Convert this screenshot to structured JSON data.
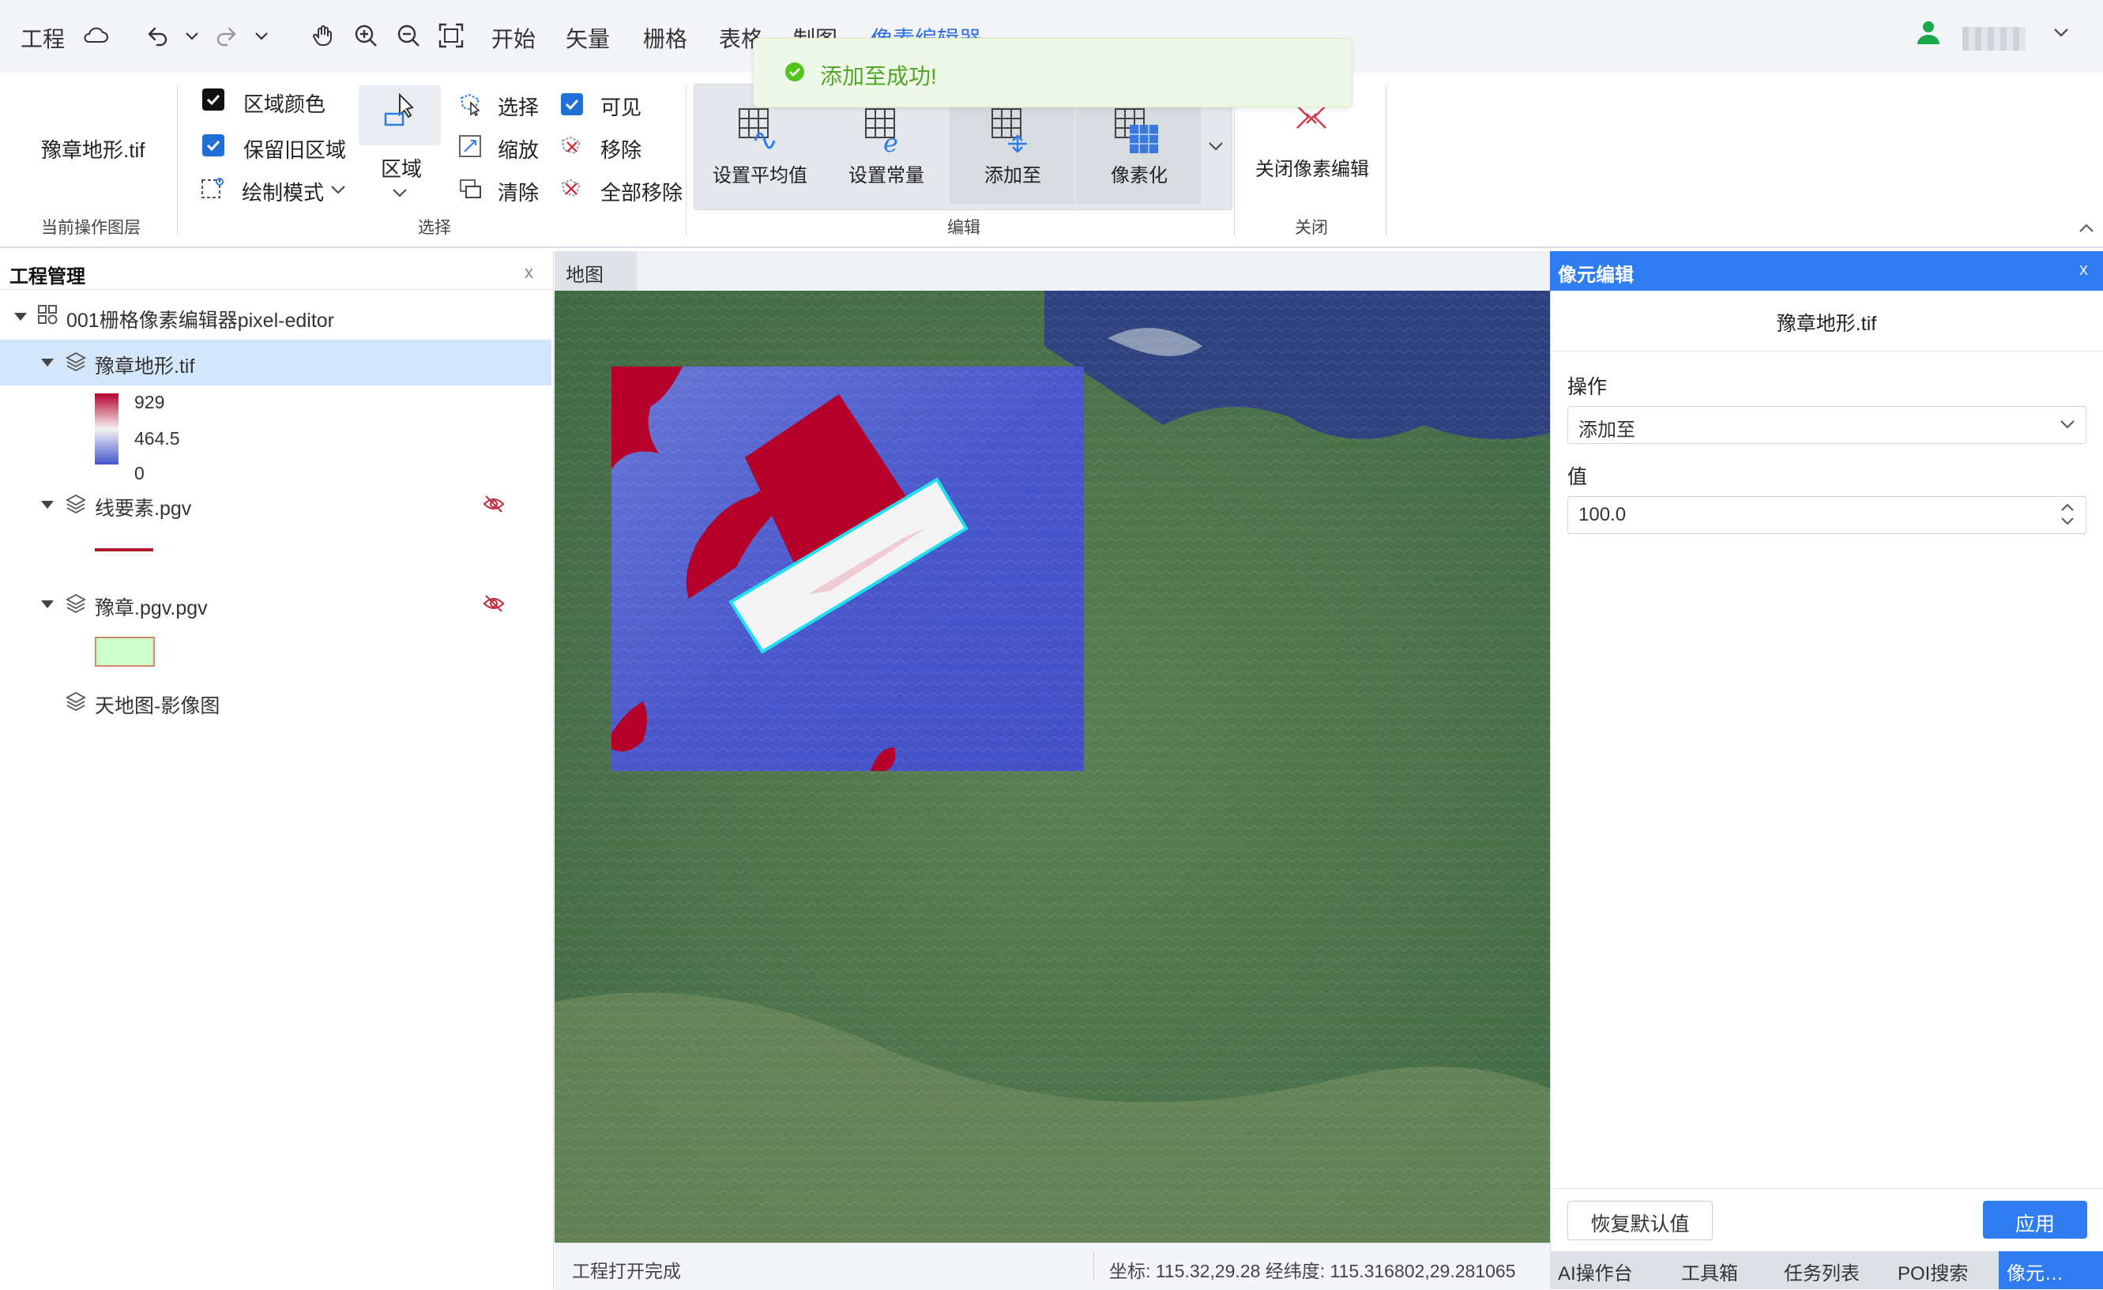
{
  "menubar": {
    "project_label": "工程",
    "menus": [
      "开始",
      "矢量",
      "栅格",
      "表格",
      "制图",
      "像素编辑器"
    ],
    "user_name": "user"
  },
  "toast": {
    "message": "添加至成功!"
  },
  "ribbon": {
    "current_layer": {
      "name": "豫章地形.tif",
      "group_label": "当前操作图层"
    },
    "select_group": {
      "region_color": "区域颜色",
      "keep_old_region": "保留旧区域",
      "draw_mode": "绘制模式",
      "region_button": "区域",
      "select": "选择",
      "zoom": "缩放",
      "clear": "清除",
      "visible": "可见",
      "remove": "移除",
      "remove_all": "全部移除",
      "group_label": "选择"
    },
    "edit_group": {
      "set_mean": "设置平均值",
      "set_constant": "设置常量",
      "add_to": "添加至",
      "pixelate": "像素化",
      "group_label": "编辑"
    },
    "close_group": {
      "close_editor": "关闭像素编辑",
      "group_label": "关闭"
    }
  },
  "left_panel": {
    "title": "工程管理",
    "close": "x",
    "project_name": "001栅格像素编辑器pixel-editor",
    "layers": [
      {
        "name": "豫章地形.tif",
        "selected": true
      },
      {
        "name": "线要素.pgv",
        "hidden": true
      },
      {
        "name": "豫章.pgv.pgv",
        "hidden": true
      },
      {
        "name": "天地图-影像图"
      }
    ],
    "legend": {
      "max": "929",
      "mid": "464.5",
      "min": "0"
    },
    "colors": {
      "line_legend": "#b01a2a",
      "polygon_fill": "#ccffcc",
      "polygon_stroke": "#d08a6a",
      "selected_row": "#d4e7fa"
    }
  },
  "map": {
    "tab_label": "地图",
    "status_left": "工程打开完成",
    "status_right": "坐标: 115.32,29.28 经纬度: 115.316802,29.281065",
    "colors": {
      "raster_low": "#4455cc",
      "raster_high": "#b5002b",
      "selection_outline": "#20e0f0"
    }
  },
  "right_panel": {
    "title": "像元编辑",
    "close": "x",
    "file_name": "豫章地形.tif",
    "operation_label": "操作",
    "operation_value": "添加至",
    "value_label": "值",
    "value": "100.0",
    "reset_button": "恢复默认值",
    "apply_button": "应用"
  },
  "bottom_tabs": [
    "AI操作台",
    "工具箱",
    "任务列表",
    "POI搜索",
    "像元…"
  ],
  "accent_color": "#2f7bf0"
}
